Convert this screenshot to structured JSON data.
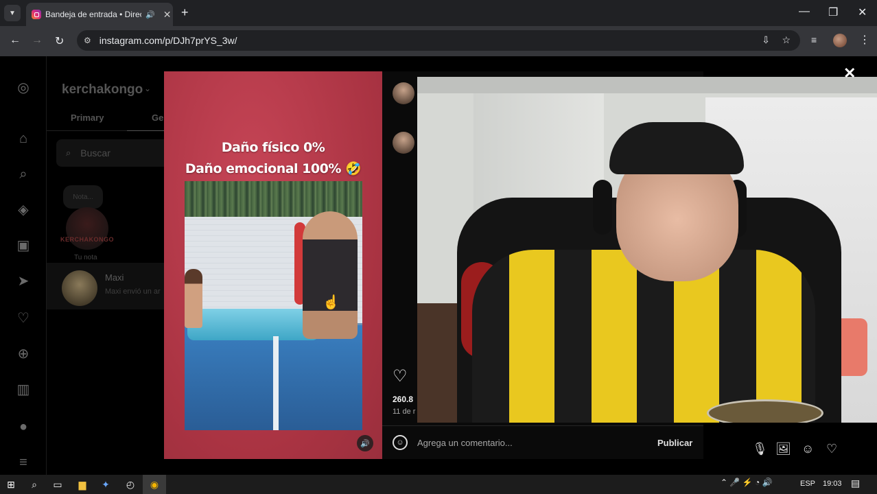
{
  "browser": {
    "tab_title": "Bandeja de entrada • Direct",
    "new_tab_label": "+",
    "url": "instagram.com/p/DJh7prYS_3w/"
  },
  "instagram": {
    "username": "kerchakongo",
    "tabs": [
      "Primary",
      "Ge"
    ],
    "search_placeholder": "Buscar",
    "note_bubble": "Nota...",
    "note_avatar_text": "KERCHAKONGO",
    "note_label": "Tu nota",
    "conversation": {
      "name": "Maxi",
      "preview": "Maxi envió un ar"
    }
  },
  "post": {
    "caption_line1": "Daño físico 0%",
    "caption_line2": "Daño emocional 100% 🤣",
    "likes": "260.8",
    "date": "11 de r",
    "comment_placeholder": "Agrega un comentario...",
    "publish_label": "Publicar"
  },
  "taskbar": {
    "language": "ESP",
    "time": "19:03"
  },
  "colors": {
    "post_background": "#b73a4a",
    "browser_bg": "#202124",
    "toolbar_bg": "#35363a"
  }
}
